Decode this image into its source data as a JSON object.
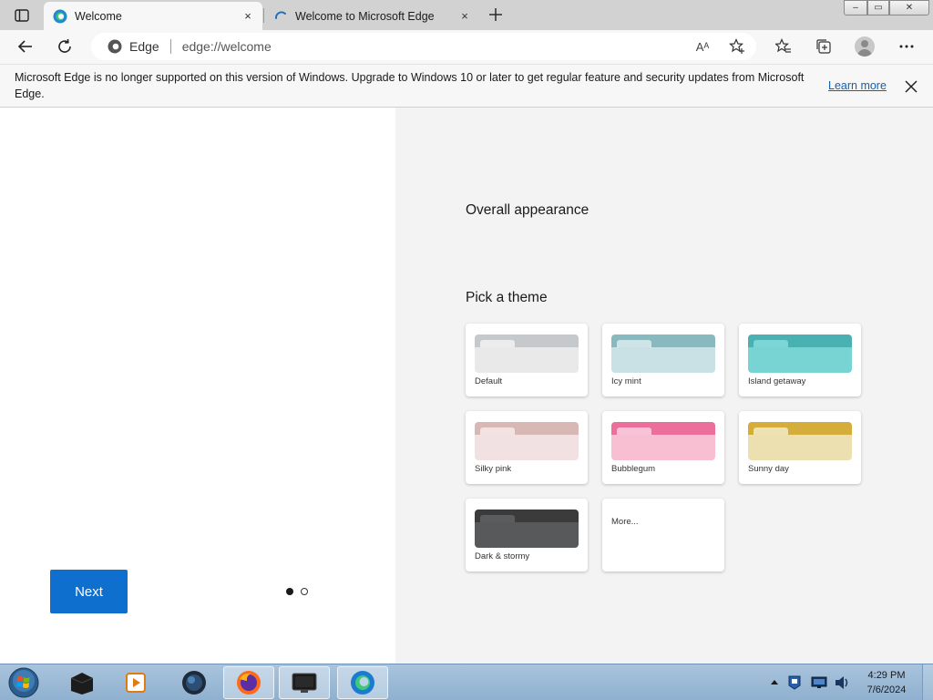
{
  "tabs": [
    {
      "title": "Welcome",
      "close": "×"
    },
    {
      "title": "Welcome to Microsoft Edge",
      "close": "×"
    }
  ],
  "window_controls": {
    "minimize": "–",
    "maximize": "▭",
    "close": "✕"
  },
  "address_bar": {
    "site_name": "Edge",
    "url": "edge://welcome",
    "read_aloud": "Aᴬ"
  },
  "info_bar": {
    "message": "Microsoft Edge is no longer supported on this version of Windows. Upgrade to Windows 10 or later to get regular feature and security updates from Microsoft Edge.",
    "learn_more": "Learn more"
  },
  "welcome": {
    "next_label": "Next",
    "overall_appearance": "Overall appearance",
    "pick_theme": "Pick a theme",
    "themes": [
      {
        "label": "Default",
        "bar": "#c6c9cb",
        "body": "#e9e9e9",
        "tab": "#ececec"
      },
      {
        "label": "Icy mint",
        "bar": "#87b9bf",
        "body": "#c9e1e5",
        "tab": "#cfe4e6"
      },
      {
        "label": "Island getaway",
        "bar": "#49b1b2",
        "body": "#78d3d3",
        "tab": "#7dd5d5"
      },
      {
        "label": "Silky pink",
        "bar": "#d8b8b4",
        "body": "#f1e1e2",
        "tab": "#f2e2e2"
      },
      {
        "label": "Bubblegum",
        "bar": "#ec6f9b",
        "body": "#f8bfd2",
        "tab": "#f8c3d5"
      },
      {
        "label": "Sunny day",
        "bar": "#d5ad3b",
        "body": "#ece0b0",
        "tab": "#eee2b4"
      },
      {
        "label": "Dark & stormy",
        "bar": "#3b3b3c",
        "body": "#58595b",
        "tab": "#5b5c5e"
      }
    ],
    "more_label": "More..."
  },
  "taskbar": {
    "time": "4:29 PM",
    "date": "7/6/2024"
  },
  "colors": {
    "accent": "#0f6fcf",
    "link": "#0f62b5"
  }
}
